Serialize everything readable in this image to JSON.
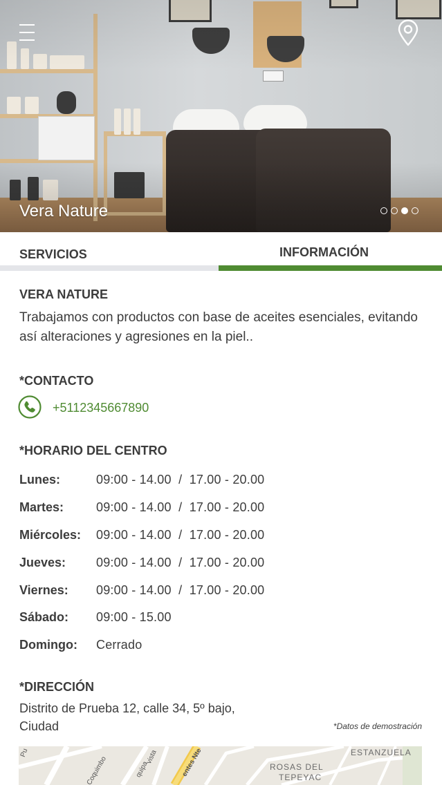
{
  "hero": {
    "title": "Vera Nature",
    "slides": 4,
    "active_slide": 3
  },
  "tabs": [
    {
      "label": "SERVICIOS",
      "active": false
    },
    {
      "label": "INFORMACIÓN",
      "active": true
    }
  ],
  "about": {
    "title": "VERA NATURE",
    "description": "Trabajamos con productos con base de aceites esenciales, evitando así alteraciones y agresiones en la piel.."
  },
  "contact": {
    "title": "*CONTACTO",
    "phone": "+5112345667890"
  },
  "schedule": {
    "title": "*HORARIO DEL CENTRO",
    "rows": [
      {
        "day": "Lunes:",
        "hours": "09:00 - 14.00  /  17.00 - 20.00"
      },
      {
        "day": "Martes:",
        "hours": "09:00 - 14.00  /  17.00 - 20.00"
      },
      {
        "day": "Miércoles:",
        "hours": "09:00 - 14.00  /  17.00 - 20.00"
      },
      {
        "day": "Jueves:",
        "hours": "09:00 - 14.00  /  17.00 - 20.00"
      },
      {
        "day": "Viernes:",
        "hours": "09:00 - 14.00  /  17.00 - 20.00"
      },
      {
        "day": "Sábado:",
        "hours": "09:00 - 15.00"
      },
      {
        "day": "Domingo:",
        "hours": "Cerrado"
      }
    ]
  },
  "address": {
    "title": "*DIRECCIÓN",
    "line1": "Distrito de Prueba 12, calle 34, 5º bajo,",
    "line2": "Ciudad",
    "note": "*Datos de demostración"
  },
  "map": {
    "labels": [
      "ESTANZUELA",
      "ROSAS DEL",
      "TEPEYAC"
    ],
    "streets": [
      "Coquimbo",
      "Pu",
      "quipa",
      "vista",
      "entes Nte"
    ]
  },
  "colors": {
    "accent": "#4f8b32",
    "text": "#3c3c3c",
    "tab_inactive_line": "#e4e5e9"
  },
  "icons": {
    "menu": "hamburger-menu-icon",
    "location": "map-pin-icon",
    "phone": "phone-icon"
  }
}
